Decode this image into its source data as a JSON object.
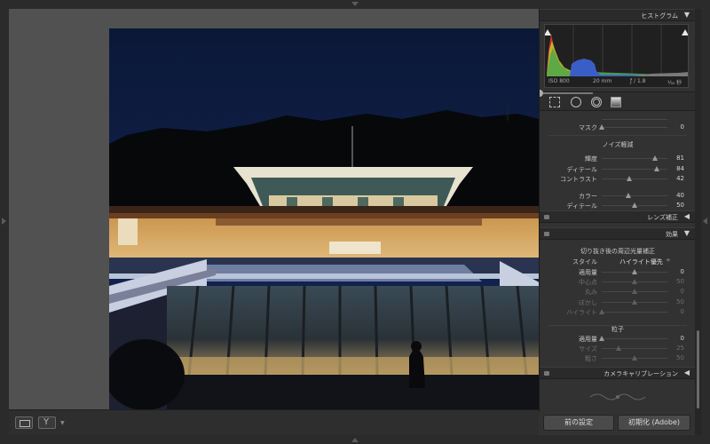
{
  "panel": {
    "histogram": {
      "title": "ヒストグラム",
      "iso": "ISO 800",
      "focal": "20 mm",
      "aperture": "ƒ / 1.8",
      "shutter": "¹⁄₃₀ 秒"
    },
    "partial_mask": {
      "label": "マスク",
      "value": "0",
      "fraction": 0.0
    },
    "noise": {
      "title": "ノイズ軽減",
      "sliders": [
        {
          "label": "輝度",
          "value": "81",
          "fraction": 0.81
        },
        {
          "label": "ディテール",
          "value": "84",
          "fraction": 0.84
        },
        {
          "label": "コントラスト",
          "value": "42",
          "fraction": 0.42
        },
        {
          "label": "カラー",
          "value": "40",
          "fraction": 0.4
        },
        {
          "label": "ディテール",
          "value": "50",
          "fraction": 0.5
        }
      ]
    },
    "lens": {
      "title": "レンズ補正"
    },
    "effects": {
      "title": "効果",
      "vignette_title": "切り抜き後の周辺光量補正",
      "style_label": "スタイル",
      "style_value": "ハイライト優先",
      "style_caret": "÷",
      "sliders": [
        {
          "label": "適用量",
          "value": "0",
          "fraction": 0.5,
          "dim": false
        },
        {
          "label": "中心点",
          "value": "50",
          "fraction": 0.5,
          "dim": true
        },
        {
          "label": "丸み",
          "value": "0",
          "fraction": 0.5,
          "dim": true
        },
        {
          "label": "ぼかし",
          "value": "50",
          "fraction": 0.5,
          "dim": true
        },
        {
          "label": "ハイライト",
          "value": "0",
          "fraction": 0.0,
          "dim": true
        }
      ],
      "grain_title": "粒子",
      "grain_sliders": [
        {
          "label": "適用量",
          "value": "0",
          "fraction": 0.0,
          "dim": false
        },
        {
          "label": "サイズ",
          "value": "25",
          "fraction": 0.25,
          "dim": true
        },
        {
          "label": "粗さ",
          "value": "50",
          "fraction": 0.5,
          "dim": true
        }
      ]
    },
    "calibration": {
      "title": "カメラキャリブレーション"
    }
  },
  "buttons": {
    "previous": "前の設定",
    "reset": "初期化 (Adobe)"
  },
  "icons": {
    "collapse": "▼",
    "expand": "◀"
  }
}
